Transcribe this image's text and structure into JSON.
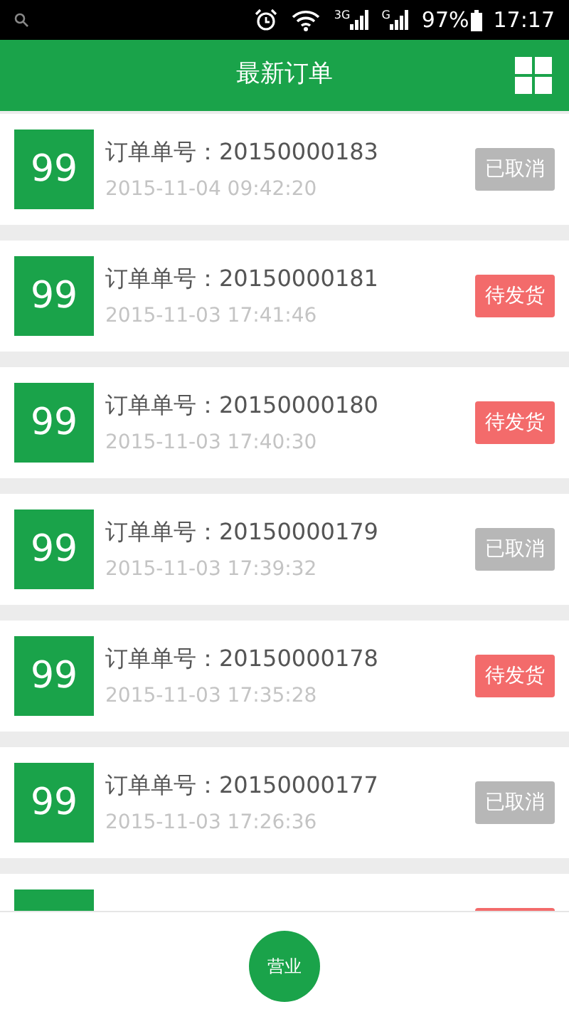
{
  "status_bar": {
    "network_1": "3G",
    "network_2": "G",
    "battery": "97%",
    "time": "17:17"
  },
  "header": {
    "title": "最新订单"
  },
  "orders": [
    {
      "count": "99",
      "number": "订单单号：20150000183",
      "time": "2015-11-04 09:42:20",
      "status": "已取消",
      "kind": "cancelled"
    },
    {
      "count": "99",
      "number": "订单单号：20150000181",
      "time": "2015-11-03 17:41:46",
      "status": "待发货",
      "kind": "pending"
    },
    {
      "count": "99",
      "number": "订单单号：20150000180",
      "time": "2015-11-03 17:40:30",
      "status": "待发货",
      "kind": "pending"
    },
    {
      "count": "99",
      "number": "订单单号：20150000179",
      "time": "2015-11-03 17:39:32",
      "status": "已取消",
      "kind": "cancelled"
    },
    {
      "count": "99",
      "number": "订单单号：20150000178",
      "time": "2015-11-03 17:35:28",
      "status": "待发货",
      "kind": "pending"
    },
    {
      "count": "99",
      "number": "订单单号：20150000177",
      "time": "2015-11-03 17:26:36",
      "status": "已取消",
      "kind": "cancelled"
    },
    {
      "kind": "pending"
    }
  ],
  "bottom": {
    "button": "营业"
  }
}
